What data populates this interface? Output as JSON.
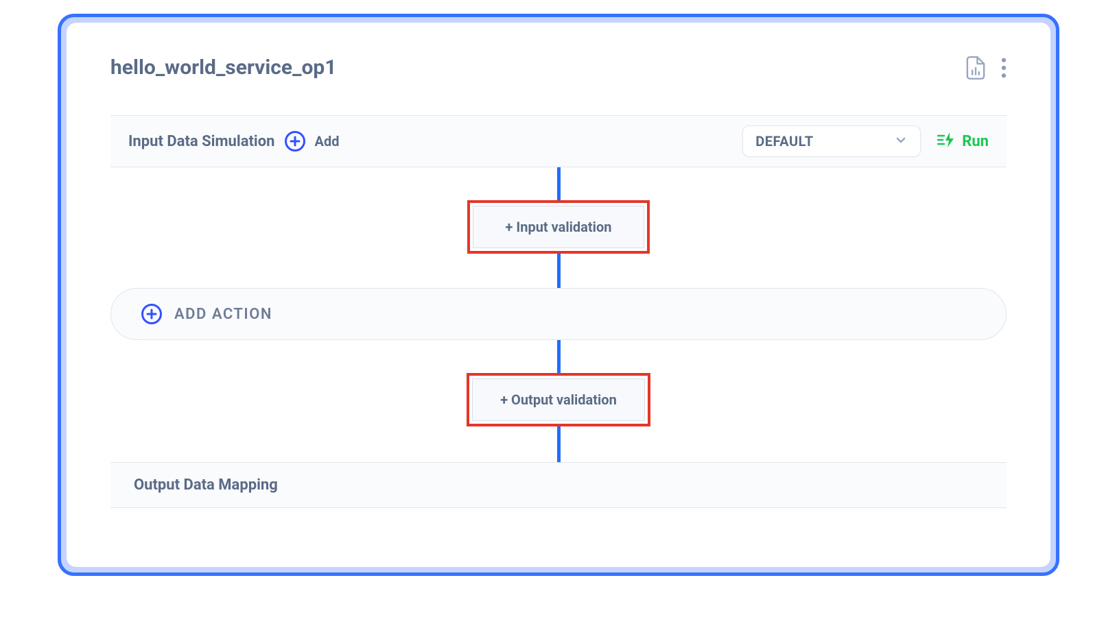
{
  "header": {
    "title": "hello_world_service_op1"
  },
  "input_section": {
    "label": "Input Data Simulation",
    "add_label": "Add",
    "select_value": "DEFAULT",
    "run_label": "Run"
  },
  "flow": {
    "input_validation_label": "+ Input validation",
    "add_action_label": "ADD ACTION",
    "output_validation_label": "+ Output validation"
  },
  "output_section": {
    "label": "Output Data Mapping"
  }
}
